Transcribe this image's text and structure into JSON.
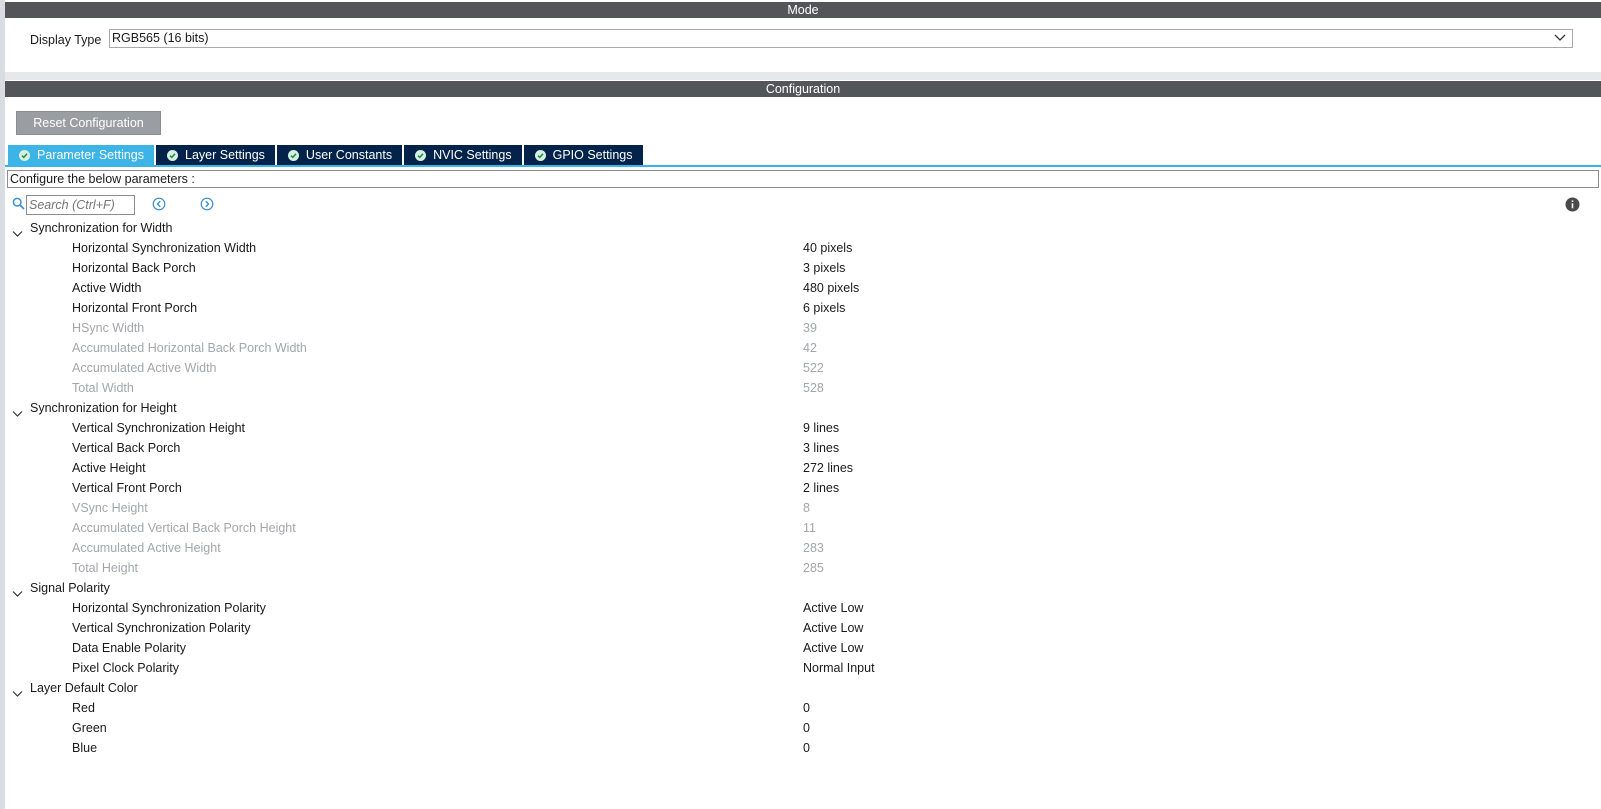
{
  "mode": {
    "title": "Mode",
    "display_type_label": "Display Type",
    "display_type_value": "RGB565 (16 bits)"
  },
  "configuration": {
    "title": "Configuration",
    "reset_label": "Reset Configuration",
    "tabs": [
      {
        "label": "Parameter Settings",
        "active": true
      },
      {
        "label": "Layer Settings"
      },
      {
        "label": "User Constants"
      },
      {
        "label": "NVIC Settings"
      },
      {
        "label": "GPIO Settings"
      }
    ],
    "description": "Configure the below parameters :",
    "search_placeholder": "Search (Ctrl+F)"
  },
  "groups": [
    {
      "label": "Synchronization for Width",
      "params": [
        {
          "label": "Horizontal Synchronization Width",
          "value": "40 pixels"
        },
        {
          "label": "Horizontal Back Porch",
          "value": "3 pixels"
        },
        {
          "label": "Active Width",
          "value": "480 pixels"
        },
        {
          "label": "Horizontal Front Porch",
          "value": "6 pixels"
        },
        {
          "label": "HSync Width",
          "value": "39",
          "disabled": true
        },
        {
          "label": "Accumulated Horizontal Back Porch Width",
          "value": "42",
          "disabled": true
        },
        {
          "label": "Accumulated Active Width",
          "value": "522",
          "disabled": true
        },
        {
          "label": "Total Width",
          "value": "528",
          "disabled": true
        }
      ]
    },
    {
      "label": "Synchronization for Height",
      "params": [
        {
          "label": "Vertical Synchronization Height",
          "value": "9 lines"
        },
        {
          "label": "Vertical Back Porch",
          "value": "3 lines"
        },
        {
          "label": "Active Height",
          "value": "272 lines"
        },
        {
          "label": "Vertical Front Porch",
          "value": "2 lines"
        },
        {
          "label": "VSync Height",
          "value": "8",
          "disabled": true
        },
        {
          "label": "Accumulated Vertical Back Porch Height",
          "value": "11",
          "disabled": true
        },
        {
          "label": "Accumulated Active Height",
          "value": "283",
          "disabled": true
        },
        {
          "label": "Total Height",
          "value": "285",
          "disabled": true
        }
      ]
    },
    {
      "label": "Signal Polarity",
      "params": [
        {
          "label": "Horizontal Synchronization Polarity",
          "value": "Active Low"
        },
        {
          "label": "Vertical Synchronization Polarity",
          "value": "Active Low"
        },
        {
          "label": "Data Enable Polarity",
          "value": "Active Low"
        },
        {
          "label": "Pixel Clock Polarity",
          "value": "Normal Input"
        }
      ]
    },
    {
      "label": "Layer Default Color",
      "params": [
        {
          "label": "Red",
          "value": "0"
        },
        {
          "label": "Green",
          "value": "0"
        },
        {
          "label": "Blue",
          "value": "0"
        }
      ]
    }
  ]
}
